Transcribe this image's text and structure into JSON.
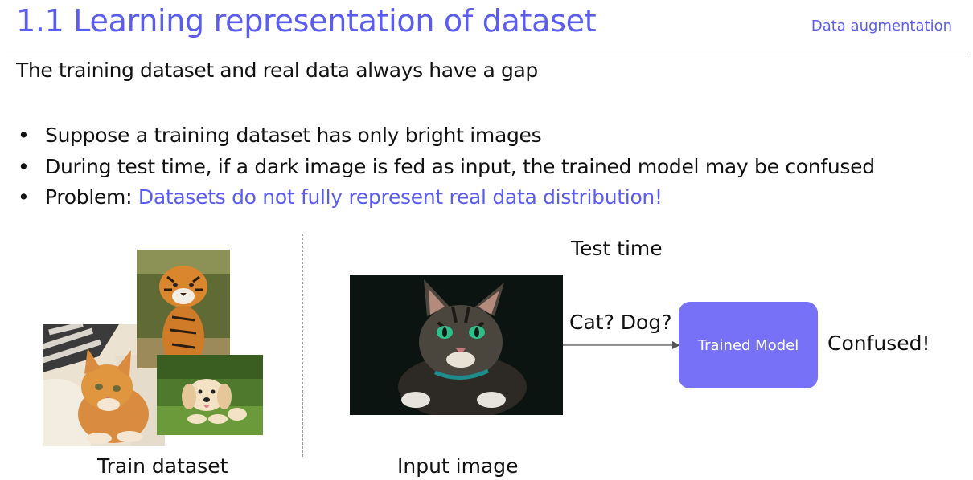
{
  "slide": {
    "title": "1.1 Learning representation of dataset",
    "section_tag": "Data augmentation",
    "subtitle": "The training dataset and real data always have a gap"
  },
  "bullets": [
    {
      "text": "Suppose a training dataset has only bright images"
    },
    {
      "text": "During test time, if a dark image is fed as input, the trained model may be confused"
    },
    {
      "prefix": "Problem: ",
      "highlight": "Datasets do not fully represent real data distribution!"
    }
  ],
  "figure": {
    "train_caption": "Train dataset",
    "test_time_label": "Test time",
    "input_caption": "Input image",
    "question_label": "Cat? Dog?",
    "model_label": "Trained Model",
    "result_label": "Confused!"
  },
  "colors": {
    "accent": "#5b5df0",
    "model_box": "#7671f7"
  },
  "icons": {
    "bullet": "•"
  }
}
